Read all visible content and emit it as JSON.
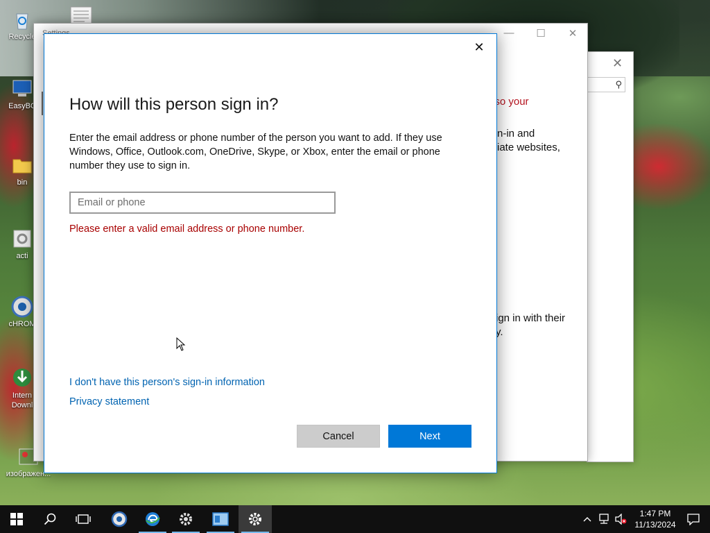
{
  "desktop": {
    "icons": [
      {
        "label": "Recycle"
      },
      {
        "label": "EasyBC"
      },
      {
        "label": "bin"
      },
      {
        "label": "acti"
      },
      {
        "label": "cHROM"
      },
      {
        "label": "Intern Downl"
      },
      {
        "label": "изображен..."
      }
    ]
  },
  "background_window": {
    "title": "Settings",
    "text_lines": [
      "w, so your",
      "n-in and",
      "iate websites,",
      "ign in with their",
      "y."
    ]
  },
  "dialog": {
    "title": "How will this person sign in?",
    "description": "Enter the email address or phone number of the person you want to add. If they use Windows, Office, Outlook.com, OneDrive, Skype, or Xbox, enter the email or phone number they use to sign in.",
    "email_placeholder": "Email or phone",
    "email_value": "",
    "error_message": "Please enter a valid email address or phone number.",
    "no_info_link": "I don't have this person's sign-in information",
    "privacy_link": "Privacy statement",
    "cancel_label": "Cancel",
    "next_label": "Next",
    "close_glyph": "✕"
  },
  "taskbar": {
    "clock_time": "1:47 PM",
    "clock_date": "11/13/2024"
  },
  "colors": {
    "accent": "#0078d7",
    "error": "#a80000",
    "link": "#0063b1",
    "taskbar": "#101010"
  }
}
